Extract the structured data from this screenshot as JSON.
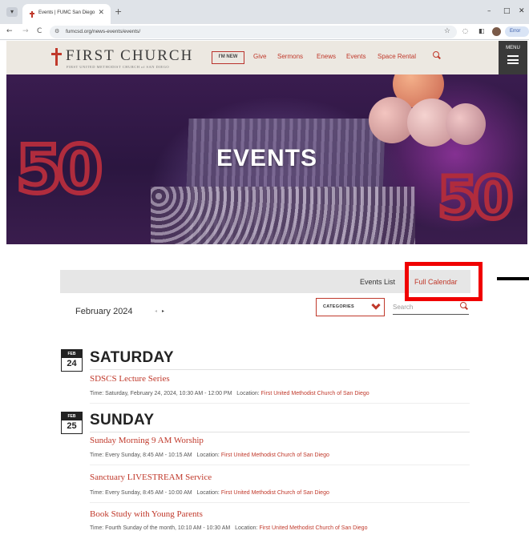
{
  "browser": {
    "tab_title": "Events | FUMC San Diego",
    "tab_close": "✕",
    "new_tab": "+",
    "url": "fumcsd.org/news-events/events/",
    "error_label": "Error",
    "window_controls": {
      "minimize": "–",
      "restore": "□",
      "close": "✕"
    },
    "nav": {
      "back": "←",
      "forward": "→",
      "reload": "C"
    }
  },
  "site": {
    "logo_name": "FIRST CHURCH",
    "logo_tagline": "FIRST UNITED METHODIST CHURCH of SAN DIEGO",
    "im_new": "I'M NEW",
    "nav_links": [
      "Give",
      "Sermons",
      "Enews",
      "Events",
      "Space Rental"
    ],
    "menu_label": "MENU",
    "accent_color": "#c0392b"
  },
  "hero": {
    "title": "EVENTS",
    "balloon_number": "50"
  },
  "toolbar": {
    "view_list": "Events List",
    "view_calendar": "Full Calendar",
    "month": "February 2024",
    "categories_label": "CATEGORIES",
    "search_placeholder": "Search",
    "prev_arrow": "◂",
    "next_arrow": "▸"
  },
  "days": [
    {
      "month": "FEB",
      "day": "24",
      "name": "SATURDAY",
      "events": [
        {
          "title": "SDSCS Lecture Series",
          "time": "Time: Saturday, February 24, 2024, 10:30 AM - 12:00 PM",
          "location_label": "Location:",
          "location": "First United Methodist Church of San Diego"
        }
      ]
    },
    {
      "month": "FEB",
      "day": "25",
      "name": "SUNDAY",
      "events": [
        {
          "title": "Sunday Morning 9 AM Worship",
          "time": "Time: Every Sunday, 8:45 AM - 10:15 AM",
          "location_label": "Location:",
          "location": "First United Methodist Church of San Diego"
        },
        {
          "title": "Sanctuary LIVESTREAM Service",
          "time": "Time: Every Sunday, 8:45 AM - 10:00 AM",
          "location_label": "Location:",
          "location": "First United Methodist Church of San Diego"
        },
        {
          "title": "Book Study with Young Parents",
          "time": "Time: Fourth Sunday of the month, 10:10 AM - 10:30 AM",
          "location_label": "Location:",
          "location": "First United Methodist Church of San Diego"
        }
      ]
    }
  ]
}
